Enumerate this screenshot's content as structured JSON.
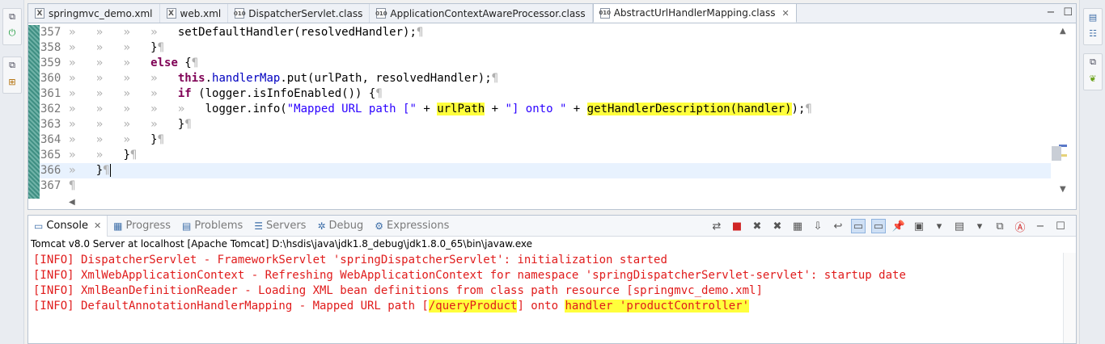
{
  "editor": {
    "tabs": [
      {
        "label": "springmvc_demo.xml",
        "icon": "X",
        "active": false
      },
      {
        "label": "web.xml",
        "icon": "X",
        "active": false
      },
      {
        "label": "DispatcherServlet.class",
        "icon": "010",
        "active": false
      },
      {
        "label": "ApplicationContextAwareProcessor.class",
        "icon": "010",
        "active": false
      },
      {
        "label": "AbstractUrlHandlerMapping.class",
        "icon": "010",
        "active": true
      }
    ],
    "lines": [
      {
        "n": "357",
        "indent": 4,
        "code": "setDefaultHandler(resolvedHandler);"
      },
      {
        "n": "358",
        "indent": 3,
        "code": "}"
      },
      {
        "n": "359",
        "indent": 3,
        "code": "else {"
      },
      {
        "n": "360",
        "indent": 4,
        "code": "this.handlerMap.put(urlPath, resolvedHandler);"
      },
      {
        "n": "361",
        "indent": 4,
        "code": "if (logger.isInfoEnabled()) {"
      },
      {
        "n": "362",
        "indent": 5,
        "code": "logger.info(\"Mapped URL path [\" + urlPath + \"] onto \" + getHandlerDescription(handler));"
      },
      {
        "n": "363",
        "indent": 4,
        "code": "}"
      },
      {
        "n": "364",
        "indent": 3,
        "code": "}"
      },
      {
        "n": "365",
        "indent": 2,
        "code": "}"
      },
      {
        "n": "366",
        "indent": 1,
        "code": "}"
      },
      {
        "n": "367",
        "indent": 0,
        "code": ""
      }
    ]
  },
  "console": {
    "tabs": [
      {
        "label": "Console",
        "active": true
      },
      {
        "label": "Progress",
        "active": false
      },
      {
        "label": "Problems",
        "active": false
      },
      {
        "label": "Servers",
        "active": false
      },
      {
        "label": "Debug",
        "active": false
      },
      {
        "label": "Expressions",
        "active": false
      }
    ],
    "header": "Tomcat v8.0 Server at localhost [Apache Tomcat] D:\\hsdis\\java\\jdk1.8_debug\\jdk1.8.0_65\\bin\\javaw.exe",
    "lines": [
      "[INFO] DispatcherServlet - FrameworkServlet 'springDispatcherServlet': initialization started",
      "[INFO] XmlWebApplicationContext - Refreshing WebApplicationContext for namespace 'springDispatcherServlet-servlet': startup date",
      "[INFO] XmlBeanDefinitionReader - Loading XML bean definitions from class path resource [springmvc_demo.xml]",
      "[INFO] DefaultAnnotationHandlerMapping - Mapped URL path [/queryProduct] onto handler 'productController'"
    ],
    "line4_parts": {
      "pre": "[INFO] DefaultAnnotationHandlerMapping - Mapped URL path [",
      "hl1": "/queryProduct",
      "mid": "] onto ",
      "hl2": "handler 'productController'"
    }
  },
  "code362": {
    "pre": "logger.info(",
    "s1": "\"Mapped URL path [\"",
    "p1": " + ",
    "hl1": "urlPath",
    "p2": " + ",
    "s2": "\"] onto \"",
    "p3": " + ",
    "hl2": "getHandlerDescription(handler)",
    "post": ");"
  },
  "colors": {
    "accent": "#ffff3c",
    "console_text": "#e01b1b",
    "keyword": "#7f0055"
  }
}
